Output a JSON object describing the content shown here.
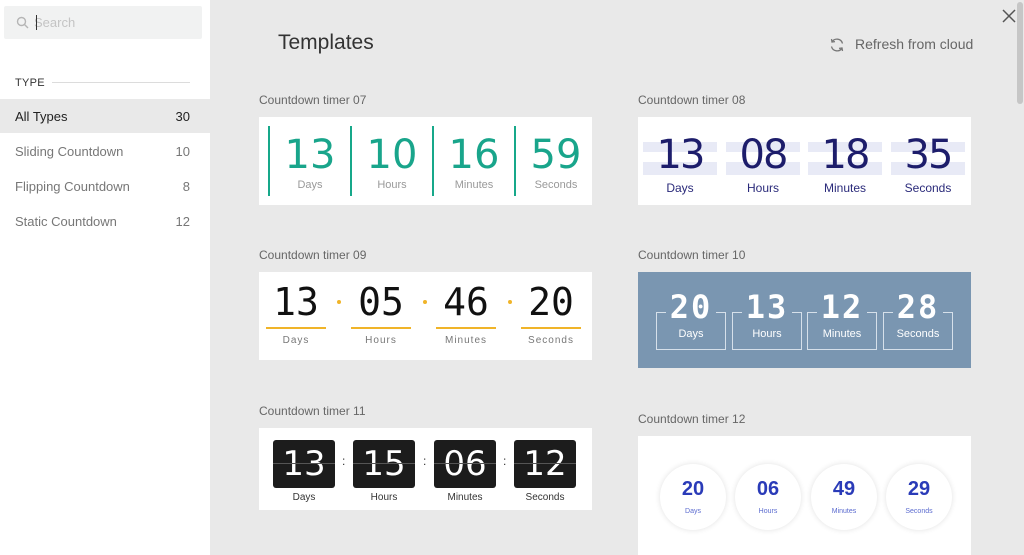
{
  "search": {
    "placeholder": "Search",
    "value": ""
  },
  "sidebar": {
    "heading": "TYPE",
    "categories": [
      {
        "label": "All Types",
        "count": "30"
      },
      {
        "label": "Sliding Countdown",
        "count": "10"
      },
      {
        "label": "Flipping Countdown",
        "count": "8"
      },
      {
        "label": "Static Countdown",
        "count": "12"
      }
    ]
  },
  "header": {
    "title": "Templates",
    "refresh_label": "Refresh from cloud"
  },
  "templates": [
    {
      "name": "Countdown timer 07",
      "values": [
        "13",
        "10",
        "16",
        "59"
      ],
      "labels": [
        "Days",
        "Hours",
        "Minutes",
        "Seconds"
      ],
      "accent": "#19a58b"
    },
    {
      "name": "Countdown timer 08",
      "values": [
        "13",
        "08",
        "18",
        "35"
      ],
      "labels": [
        "Days",
        "Hours",
        "Minutes",
        "Seconds"
      ],
      "accent": "#1d1d6b"
    },
    {
      "name": "Countdown timer 09",
      "values": [
        "13",
        "05",
        "46",
        "20"
      ],
      "labels": [
        "Days",
        "Hours",
        "Minutes",
        "Seconds"
      ],
      "accent": "#f0b429"
    },
    {
      "name": "Countdown timer 10",
      "values": [
        "20",
        "13",
        "12",
        "28"
      ],
      "labels": [
        "Days",
        "Hours",
        "Minutes",
        "Seconds"
      ],
      "accent": "#7a96b1"
    },
    {
      "name": "Countdown timer 11",
      "values": [
        "13",
        "15",
        "06",
        "12"
      ],
      "labels": [
        "Days",
        "Hours",
        "Minutes",
        "Seconds"
      ],
      "separator": ":",
      "accent": "#1c1c1c"
    },
    {
      "name": "Countdown timer 12",
      "values": [
        "20",
        "06",
        "49",
        "29"
      ],
      "labels": [
        "Days",
        "Hours",
        "Minutes",
        "Seconds"
      ],
      "accent": "#2a3bb8"
    }
  ]
}
